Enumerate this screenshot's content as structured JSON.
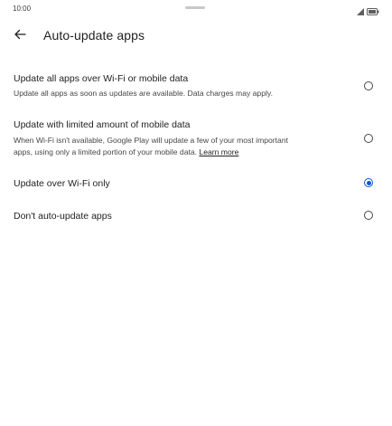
{
  "status_bar": {
    "time": "10:00"
  },
  "header": {
    "title": "Auto-update apps",
    "back_icon": "arrow-back-icon"
  },
  "accent_color": "#0b57d0",
  "options": [
    {
      "title": "Update all apps over Wi-Fi or mobile data",
      "description_lines": [
        "Update all apps as soon as updates are available. Data charges may apply."
      ],
      "selected": false
    },
    {
      "title": "Update with limited amount of mobile data",
      "description_lines": [
        "When Wi-Fi isn't available, Google Play will update a few of your most important",
        "apps, using only a limited portion of your mobile data."
      ],
      "link": "Learn more",
      "selected": false
    },
    {
      "title": "Update over Wi-Fi only",
      "selected": true
    },
    {
      "title": "Don't auto-update apps",
      "selected": false
    }
  ]
}
